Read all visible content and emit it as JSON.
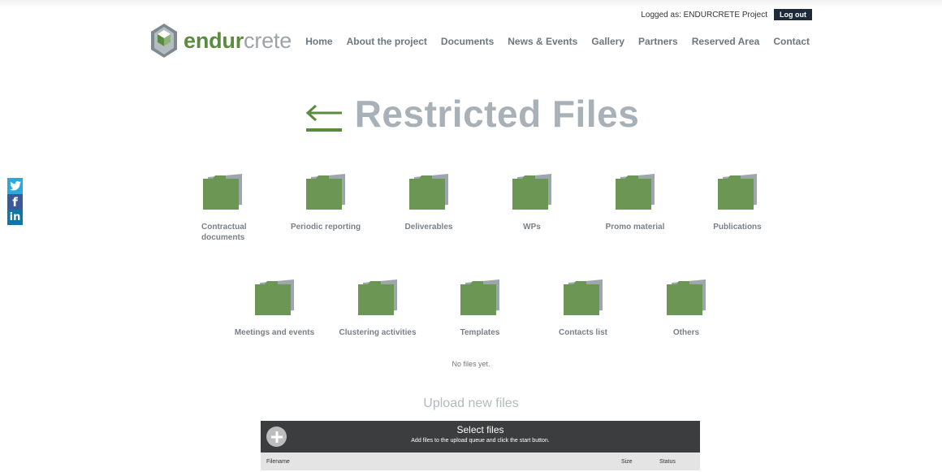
{
  "header": {
    "logged_as": "Logged as: ENDURCRETE Project",
    "logout": "Log out",
    "logo_part1": "endur",
    "logo_part2": "crete"
  },
  "nav": [
    "Home",
    "About the project",
    "Documents",
    "News & Events",
    "Gallery",
    "Partners",
    "Reserved Area",
    "Contact"
  ],
  "social": [
    "twitter-icon",
    "facebook-icon",
    "linkedin-icon"
  ],
  "page": {
    "title": "Restricted Files",
    "no_files": "No files yet."
  },
  "folders_row1": [
    "Contractual documents",
    "Periodic reporting",
    "Deliverables",
    "WPs",
    "Promo material",
    "Publications"
  ],
  "folders_row2": [
    "Meetings and events",
    "Clustering activities",
    "Templates",
    "Contacts list",
    "Others"
  ],
  "upload": {
    "heading": "Upload new files",
    "select_title": "Select files",
    "select_sub": "Add files to the upload queue and click the start button.",
    "col_filename": "Filename",
    "col_size": "Size",
    "col_status": "Status"
  },
  "colors": {
    "brand_green": "#5a8b3e",
    "folder_green": "#6b9653",
    "title_gray": "#a8b0b8",
    "dark_navy": "#1d2b3a"
  }
}
